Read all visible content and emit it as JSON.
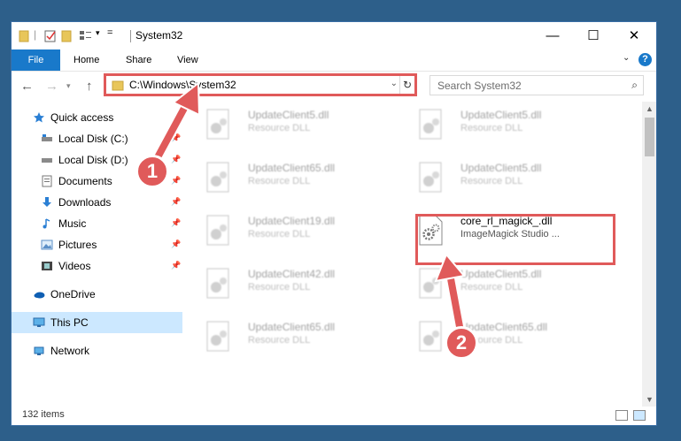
{
  "window": {
    "title": "System32",
    "controls": {
      "minimize": "—",
      "maximize": "☐",
      "close": "✕"
    }
  },
  "ribbon": {
    "tabs": [
      "File",
      "Home",
      "Share",
      "View"
    ],
    "help": "?"
  },
  "address": {
    "path": "C:\\Windows\\System32"
  },
  "search": {
    "placeholder": "Search System32"
  },
  "sidebar": {
    "quick_access": "Quick access",
    "items": [
      {
        "label": "Local Disk (C:)",
        "icon": "drive-icon",
        "pinned": true
      },
      {
        "label": "Local Disk (D:)",
        "icon": "drive-icon",
        "pinned": true
      },
      {
        "label": "Documents",
        "icon": "documents-icon",
        "pinned": true
      },
      {
        "label": "Downloads",
        "icon": "downloads-icon",
        "pinned": true
      },
      {
        "label": "Music",
        "icon": "music-icon",
        "pinned": true
      },
      {
        "label": "Pictures",
        "icon": "pictures-icon",
        "pinned": true
      },
      {
        "label": "Videos",
        "icon": "videos-icon",
        "pinned": true
      }
    ],
    "onedrive": "OneDrive",
    "this_pc": "This PC",
    "network": "Network"
  },
  "files": [
    {
      "name": "UpdateClient5.dll",
      "type": "Resource DLL"
    },
    {
      "name": "UpdateClient5.dll",
      "type": "Resource DLL"
    },
    {
      "name": "UpdateClient65.dll",
      "type": "Resource DLL"
    },
    {
      "name": "UpdateClient5.dll",
      "type": "Resource DLL"
    },
    {
      "name": "UpdateClient19.dll",
      "type": "Resource DLL"
    },
    {
      "name": "core_rl_magick_.dll",
      "type": "ImageMagick Studio ..."
    },
    {
      "name": "UpdateClient42.dll",
      "type": "Resource DLL"
    },
    {
      "name": "UpdateClient5.dll",
      "type": "Resource DLL"
    },
    {
      "name": "UpdateClient65.dll",
      "type": "Resource DLL"
    },
    {
      "name": "UpdateClient65.dll",
      "type": "Resource DLL"
    }
  ],
  "status": {
    "count": "132 items"
  },
  "callouts": [
    "1",
    "2"
  ],
  "colors": {
    "accent": "#1979ca",
    "highlight": "#e05a5a",
    "selection": "#cce8ff"
  }
}
